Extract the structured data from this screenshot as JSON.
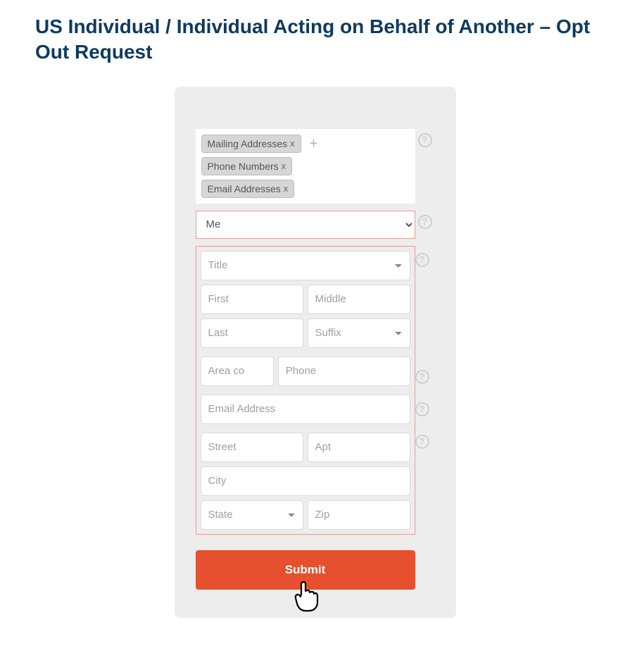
{
  "page": {
    "title": "US Individual / Individual Acting on Behalf of Another – Opt Out Request"
  },
  "tags": {
    "items": [
      {
        "label": "Mailing Addresses"
      },
      {
        "label": "Phone Numbers"
      },
      {
        "label": "Email Addresses"
      }
    ],
    "close_glyph": "x",
    "add_glyph": "+"
  },
  "subject_select": {
    "value": "Me"
  },
  "name_group": {
    "title_placeholder": "Title",
    "first_placeholder": "First",
    "middle_placeholder": "Middle",
    "last_placeholder": "Last",
    "suffix_placeholder": "Suffix"
  },
  "phone_group": {
    "area_placeholder": "Area co",
    "phone_placeholder": "Phone"
  },
  "email_group": {
    "email_placeholder": "Email Address"
  },
  "address_group": {
    "street_placeholder": "Street",
    "apt_placeholder": "Apt",
    "city_placeholder": "City",
    "state_placeholder": "State",
    "zip_placeholder": "Zip"
  },
  "submit": {
    "label": "Submit"
  },
  "help_glyph": "?"
}
